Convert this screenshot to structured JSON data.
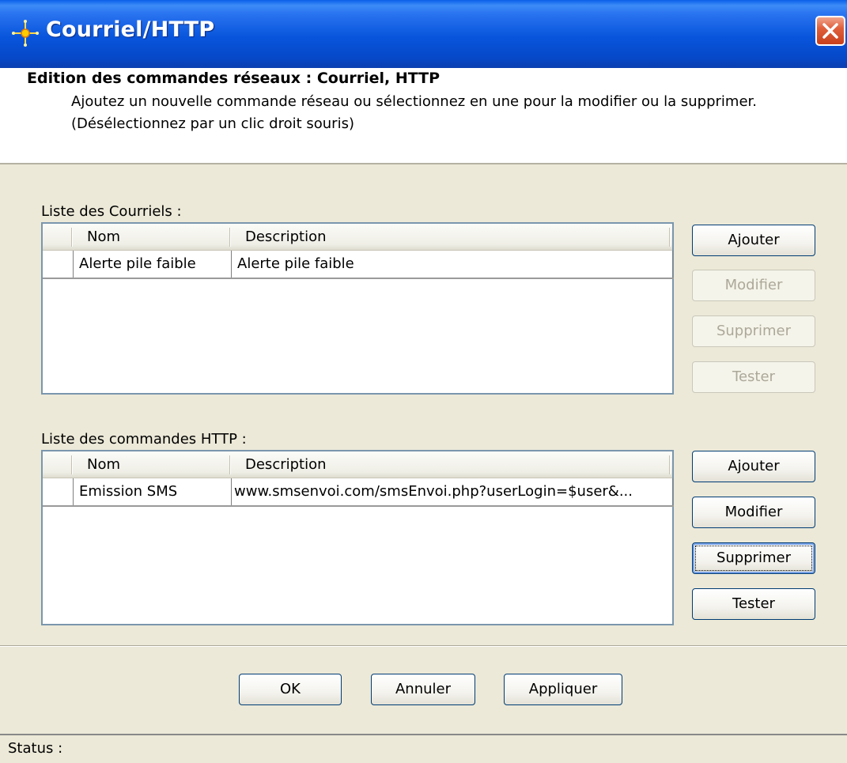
{
  "window": {
    "title": "Courriel/HTTP",
    "icon": "app-star-icon",
    "close_icon": "close-icon"
  },
  "header": {
    "title": "Edition des commandes réseaux : Courriel, HTTP",
    "line1": "Ajoutez un nouvelle commande réseau ou sélectionnez en une pour la modifier ou la supprimer.",
    "line2": "(Désélectionnez par un clic droit souris)"
  },
  "emails": {
    "label": "Liste des Courriels :",
    "columns": [
      "Nom",
      "Description"
    ],
    "rows": [
      {
        "name": "Alerte pile faible",
        "description": "Alerte pile faible"
      }
    ],
    "buttons": {
      "add": "Ajouter",
      "modify": "Modifier",
      "delete": "Supprimer",
      "test": "Tester"
    }
  },
  "http": {
    "label": "Liste des commandes HTTP :",
    "columns": [
      "Nom",
      "Description"
    ],
    "rows": [
      {
        "name": "Emission SMS",
        "description": "www.smsenvoi.com/smsEnvoi.php?userLogin=$user&..."
      }
    ],
    "buttons": {
      "add": "Ajouter",
      "modify": "Modifier",
      "delete": "Supprimer",
      "test": "Tester"
    }
  },
  "footer": {
    "ok": "OK",
    "cancel": "Annuler",
    "apply": "Appliquer"
  },
  "status": {
    "label": "Status :"
  },
  "colors": {
    "titlebar": "#0855dc",
    "face": "#ece9d8",
    "button_border": "#003c74",
    "disabled_text": "#aca899"
  }
}
